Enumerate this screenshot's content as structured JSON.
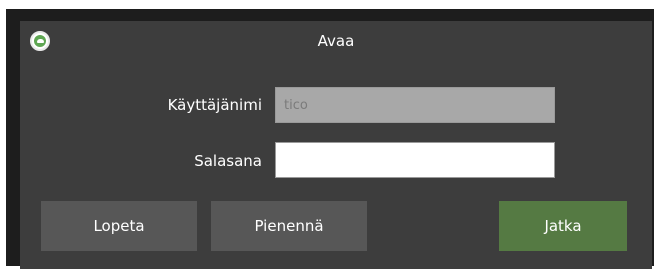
{
  "window": {
    "title": "Avaa",
    "app_icon": "green-circle-app-icon"
  },
  "form": {
    "username_label": "Käyttäjänimi",
    "username_value": "tico",
    "password_label": "Salasana",
    "password_value": ""
  },
  "buttons": {
    "quit_label": "Lopeta",
    "minimize_label": "Pienennä",
    "continue_label": "Jatka"
  },
  "colors": {
    "dialog_bg": "#3d3d3d",
    "button_bg": "#575757",
    "primary_button_bg": "#557a43",
    "disabled_field_bg": "#a8a8a8"
  }
}
